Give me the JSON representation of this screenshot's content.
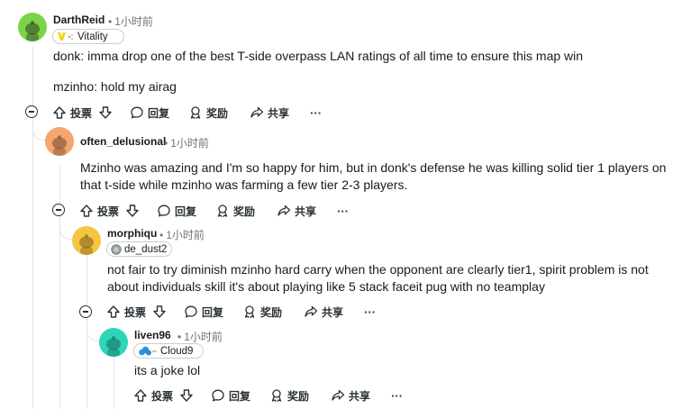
{
  "comments": [
    {
      "username": "DarthReid",
      "time": "1小时前",
      "flair": "Vitality",
      "flair_icon": "vitality-logo-icon",
      "avatar_color": "#7bd448",
      "lines": [
        "donk: imma drop one of the best T-side overpass LAN ratings of all time to ensure this map win",
        "mzinho: hold my airag"
      ]
    },
    {
      "username": "often_delusional",
      "time": "1小时前",
      "avatar_color": "#f4a570",
      "lines": [
        "Mzinho was amazing and I'm so happy for him, but in donk's defense he was killing solid tier 1 players on",
        "that t-side while mzinho was farming a few tier 2-3 players."
      ]
    },
    {
      "username": "morphiqu",
      "time": "1小时前",
      "flair": "de_dust2",
      "flair_icon": "dust2-coin-icon",
      "avatar_color": "#f5c542",
      "lines": [
        "not fair to try diminish mzinho hard carry when the opponent are clearly tier1, spirit problem is not",
        "about individuals skill it's about playing like 5 stack faceit pug with no teamplay"
      ]
    },
    {
      "username": "liven96",
      "time": "1小时前",
      "flair": "Cloud9",
      "flair_icon": "cloud9-logo-icon",
      "avatar_color": "#2ed5b8",
      "lines": [
        "its a joke lol"
      ]
    }
  ],
  "actions": {
    "upvote": "投票",
    "award": "奖励",
    "reply": "回复",
    "share": "共享",
    "more": "···"
  },
  "dot": "•",
  "colors": {
    "text": "#1a1a1b",
    "meta": "#6b7478",
    "thread_line": "#e2e4e6"
  }
}
